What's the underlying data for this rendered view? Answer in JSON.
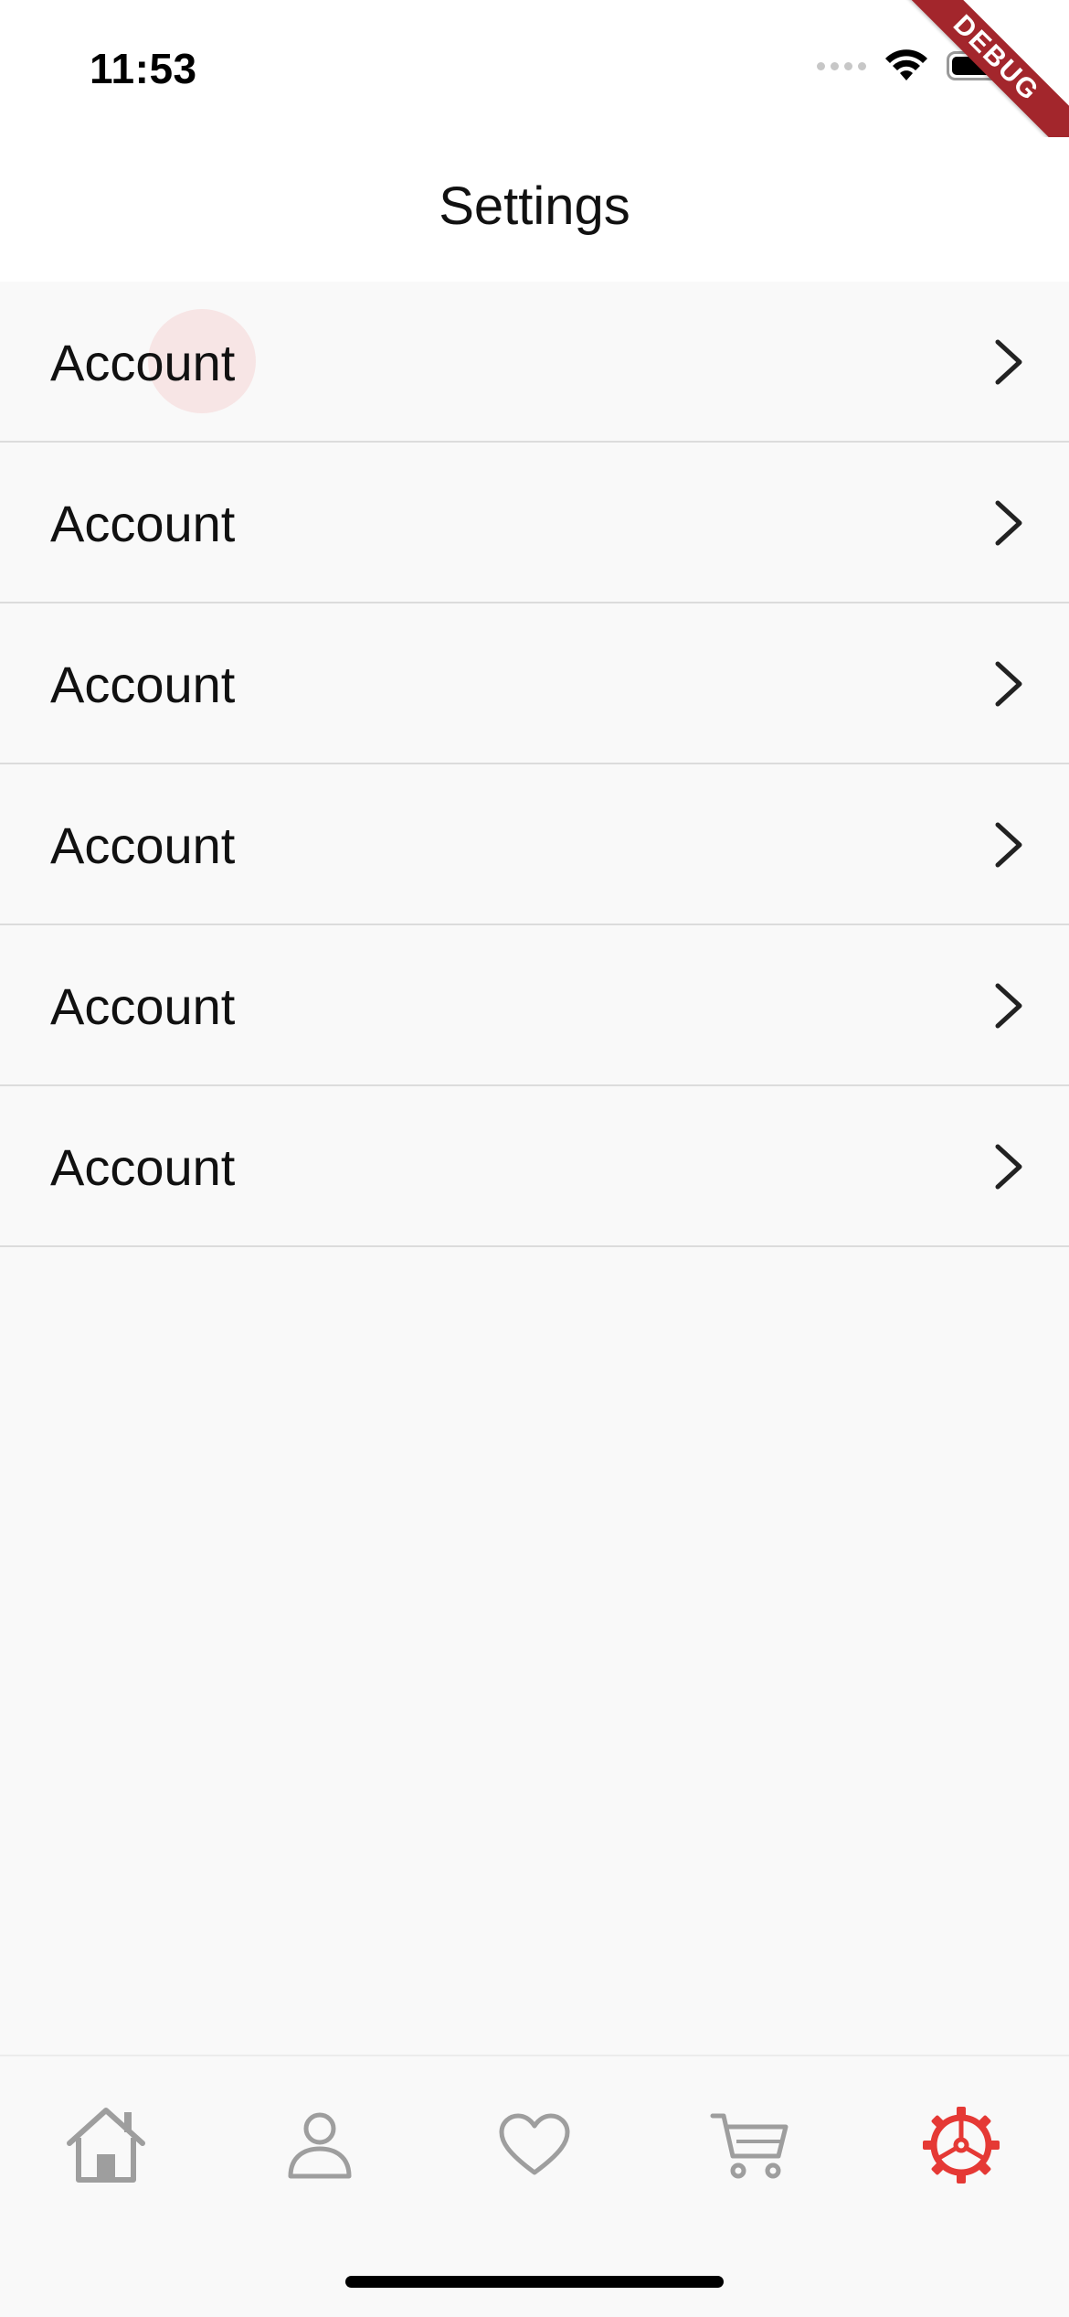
{
  "status_bar": {
    "time": "11:53"
  },
  "debug_banner": "DEBUG",
  "header": {
    "title": "Settings"
  },
  "settings": {
    "items": [
      {
        "label": "Account"
      },
      {
        "label": "Account"
      },
      {
        "label": "Account"
      },
      {
        "label": "Account"
      },
      {
        "label": "Account"
      },
      {
        "label": "Account"
      }
    ]
  },
  "bottom_nav": {
    "items": [
      {
        "icon": "home-icon",
        "active": false
      },
      {
        "icon": "person-icon",
        "active": false
      },
      {
        "icon": "heart-icon",
        "active": false
      },
      {
        "icon": "cart-icon",
        "active": false
      },
      {
        "icon": "gear-icon",
        "active": true
      }
    ],
    "active_color": "#e53935",
    "inactive_color": "#9e9e9e"
  }
}
